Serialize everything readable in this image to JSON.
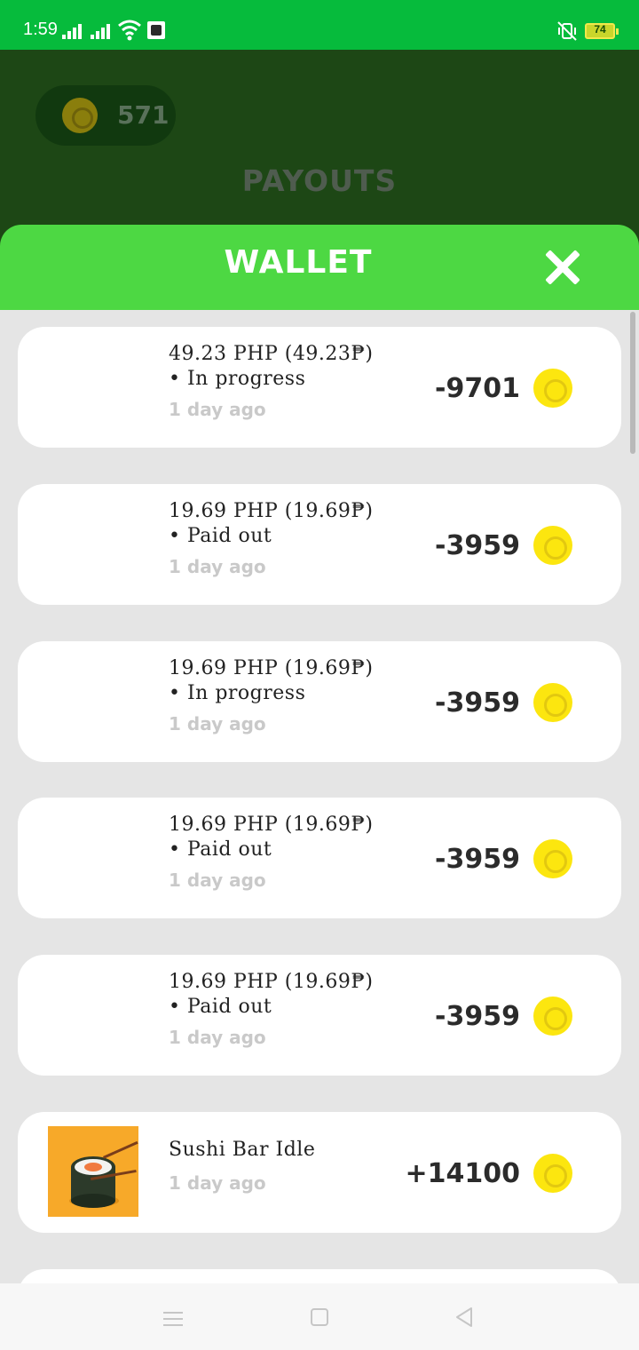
{
  "status_bar": {
    "time": "1:59",
    "battery": "74"
  },
  "background_page": {
    "coin_count": "571",
    "title": "PAYOUTS"
  },
  "wallet": {
    "title": "WALLET",
    "items": [
      {
        "line1": "49.23 PHP (49.23₱)",
        "line2": "• In progress",
        "time": "1 day ago",
        "amount": "-9701"
      },
      {
        "line1": "19.69 PHP (19.69₱)",
        "line2": "• Paid out",
        "time": "1 day ago",
        "amount": "-3959"
      },
      {
        "line1": "19.69 PHP (19.69₱)",
        "line2": "• In progress",
        "time": "1 day ago",
        "amount": "-3959"
      },
      {
        "line1": "19.69 PHP (19.69₱)",
        "line2": "• Paid out",
        "time": "1 day ago",
        "amount": "-3959"
      },
      {
        "line1": "19.69 PHP (19.69₱)",
        "line2": "• Paid out",
        "time": "1 day ago",
        "amount": "-3959"
      },
      {
        "line1": "Sushi Bar Idle",
        "time": "1 day ago",
        "amount": "+14100",
        "icon": "sushi-app-icon"
      }
    ]
  },
  "colors": {
    "status_bar": "#06bb3c",
    "header": "#4dd843",
    "coin": "#fce60f"
  }
}
